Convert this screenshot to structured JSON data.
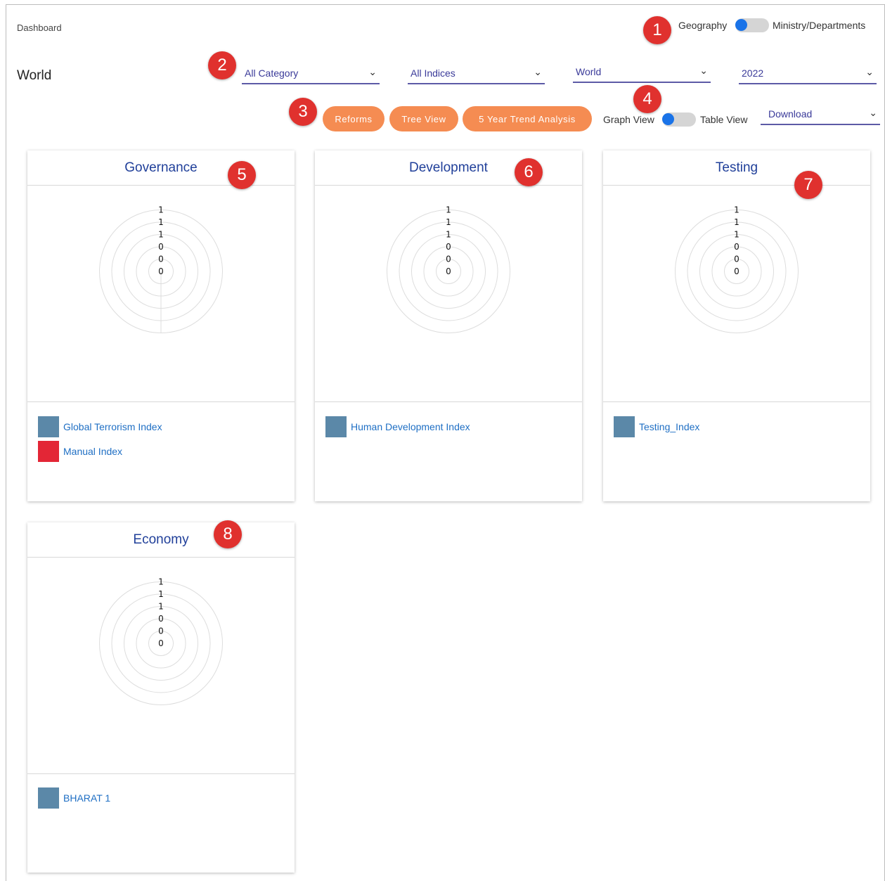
{
  "breadcrumb": "Dashboard",
  "page_title": "World",
  "header_toggle": {
    "left_label": "Geography",
    "right_label": "Ministry/Departments"
  },
  "filters": {
    "category": "All Category",
    "indices": "All Indices",
    "region": "World",
    "year": "2022"
  },
  "actions": {
    "reforms": "Reforms",
    "tree_view": "Tree View",
    "trend": "5 Year Trend Analysis"
  },
  "view_toggle": {
    "left_label": "Graph View",
    "right_label": "Table View"
  },
  "download": "Download",
  "markers": [
    "1",
    "2",
    "3",
    "4",
    "5",
    "6",
    "7",
    "8"
  ],
  "colors": {
    "accent_orange": "#f58c52",
    "title_blue": "#21409a",
    "link_blue": "#1f6fc4",
    "swatch_blue": "#5b88a8",
    "swatch_red": "#e32636",
    "marker_red": "#e0312e"
  },
  "icons": {
    "dropdown": "chevron-down-icon"
  },
  "cards": [
    {
      "title": "Governance",
      "radial_ticks": [
        "1",
        "1",
        "1",
        "0",
        "0",
        "0"
      ],
      "legend": [
        {
          "label": "Global Terrorism Index",
          "color": "#5b88a8"
        },
        {
          "label": "Manual Index",
          "color": "#e32636"
        }
      ]
    },
    {
      "title": "Development",
      "radial_ticks": [
        "1",
        "1",
        "1",
        "0",
        "0",
        "0"
      ],
      "legend": [
        {
          "label": "Human Development Index",
          "color": "#5b88a8"
        }
      ]
    },
    {
      "title": "Testing",
      "radial_ticks": [
        "1",
        "1",
        "1",
        "0",
        "0",
        "0"
      ],
      "legend": [
        {
          "label": "Testing_Index",
          "color": "#5b88a8"
        }
      ]
    },
    {
      "title": "Economy",
      "radial_ticks": [
        "1",
        "1",
        "1",
        "0",
        "0",
        "0"
      ],
      "legend": [
        {
          "label": "BHARAT 1",
          "color": "#5b88a8"
        }
      ]
    }
  ]
}
